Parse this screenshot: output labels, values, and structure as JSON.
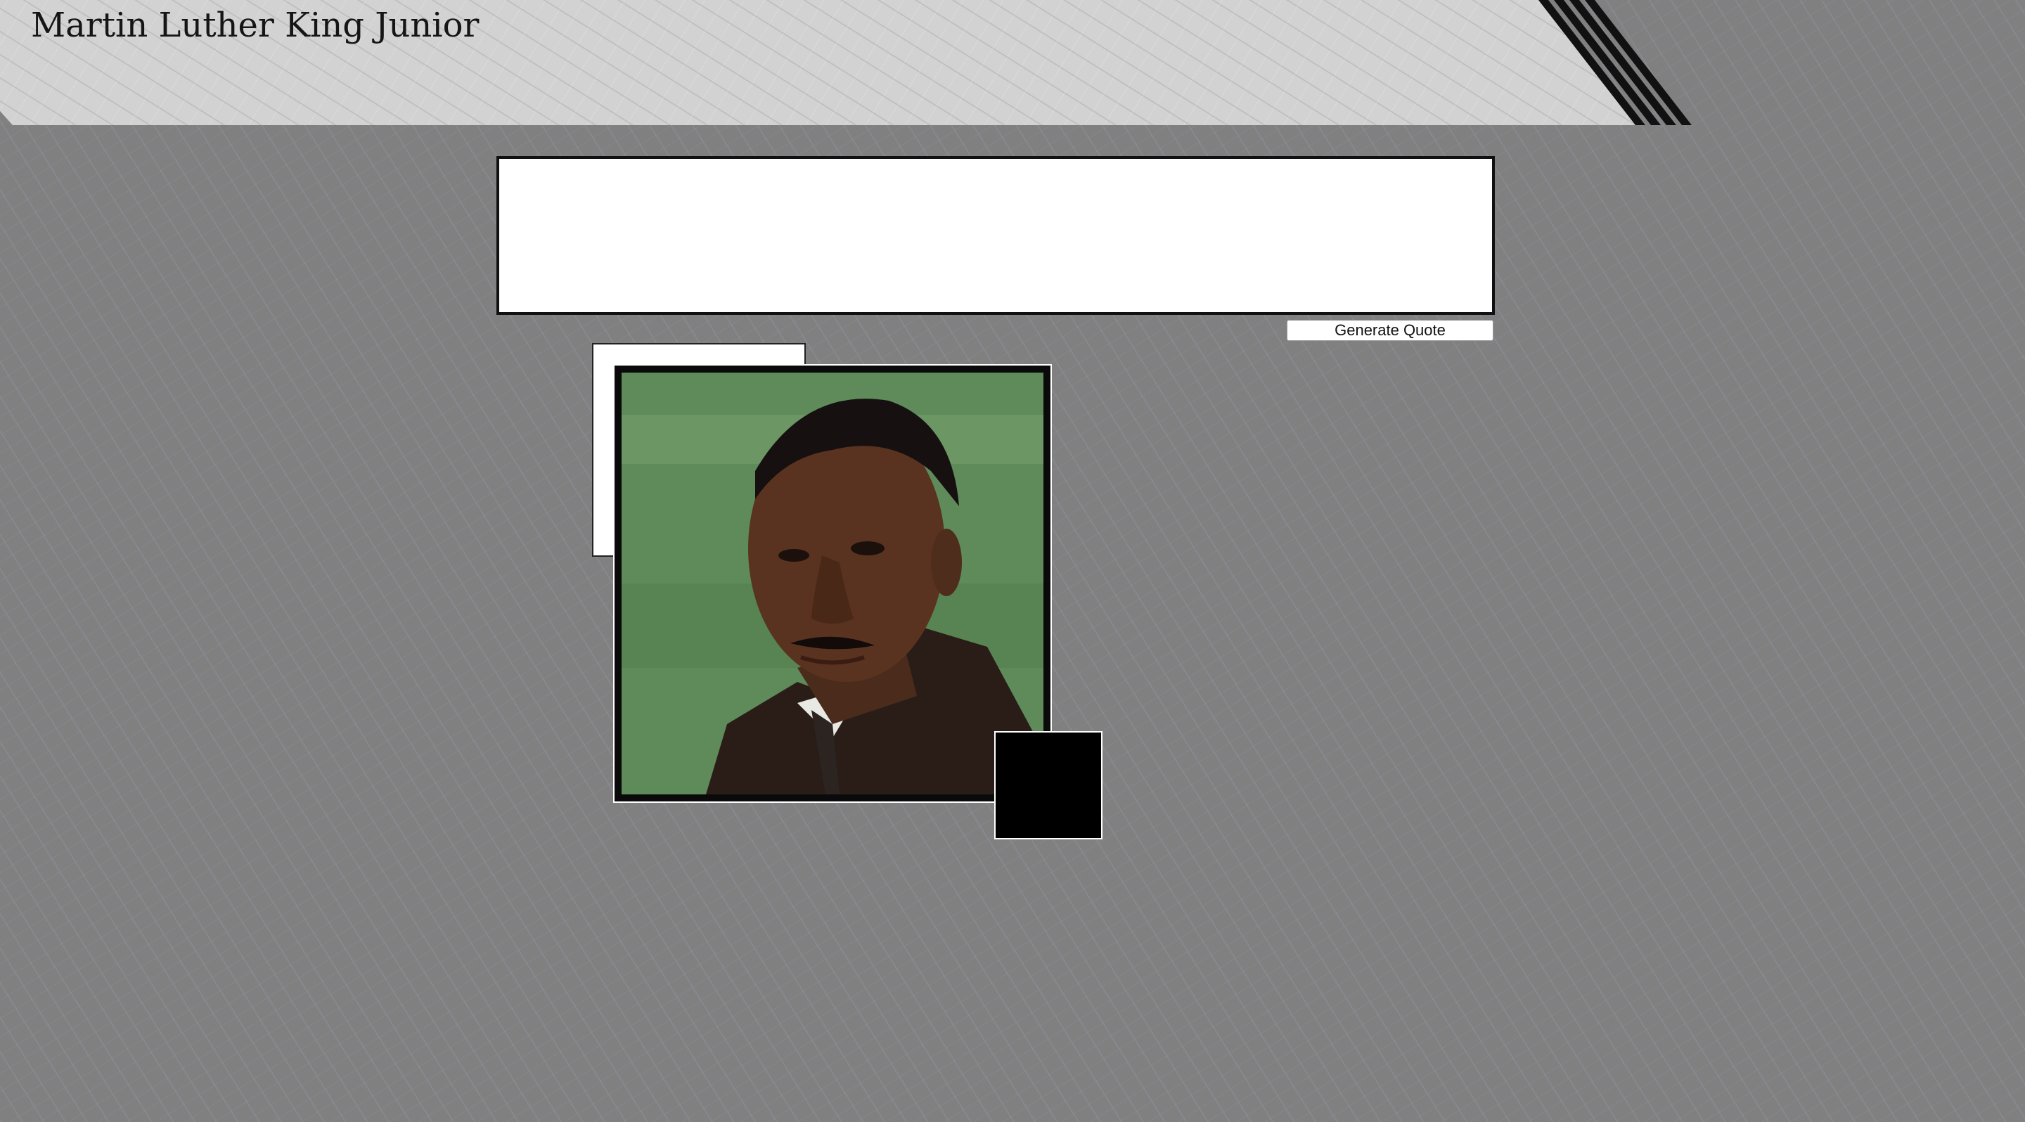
{
  "header": {
    "title": "Martin Luther King Junior"
  },
  "quote": {
    "text": ""
  },
  "controls": {
    "generate_label": "Generate Quote"
  },
  "colors": {
    "background": "#808080",
    "header": "#d2d2d2",
    "frame": "#0a0a0a",
    "accent_square": "#000000"
  },
  "icons": {
    "portrait": "portrait-photo"
  }
}
